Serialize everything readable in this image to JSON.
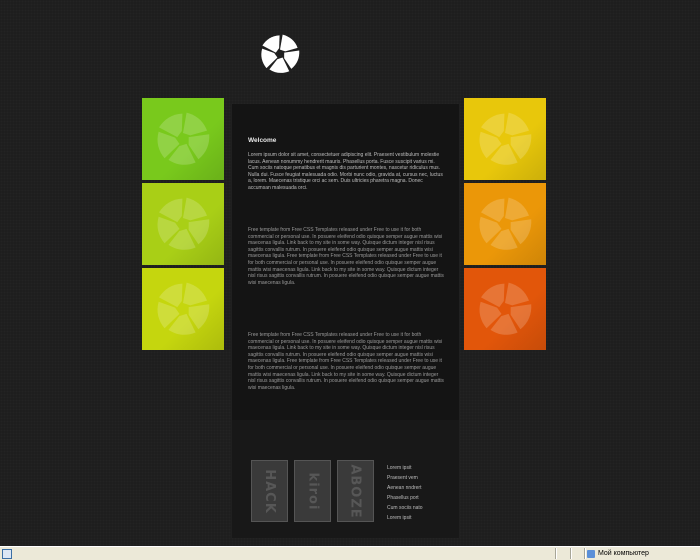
{
  "colors": {
    "page_bg": "#1e1e1e",
    "content_bg": "#141414",
    "left_tiles": [
      "#79c91c",
      "#a9cf16",
      "#c5d60e"
    ],
    "right_tiles": [
      "#e8c70b",
      "#eb9708",
      "#e2560a"
    ]
  },
  "tiles": {
    "left": [
      {
        "name": "tile-left-1",
        "color": "#79c91c"
      },
      {
        "name": "tile-left-2",
        "color": "#a9cf16"
      },
      {
        "name": "tile-left-3",
        "color": "#c5d60e"
      }
    ],
    "right": [
      {
        "name": "tile-right-1",
        "color": "#e8c70b"
      },
      {
        "name": "tile-right-2",
        "color": "#eb9708"
      },
      {
        "name": "tile-right-3",
        "color": "#e2560a"
      }
    ]
  },
  "content": {
    "welcome_title": "Welcome",
    "intro": "Lorem ipsum dolor sit amet, consectetuer adipiscing elit. Praesent vestibulum molestie lacus. Aenean nonummy hendrerit mauris. Phasellus porta. Fusce suscipit varius mi. Cum sociis natoque penatibus et magnis dis parturient montes, nascetur ridiculus mus. Nulla dui. Fusce feugiat malesuada odio. Morbi nunc odio, gravida at, cursus nec, luctus a, lorem. Maecenas tristique orci ac sem. Duis ultricies pharetra magna. Donec accumsan malesuada orci.",
    "paragraph_2": "Free template from Free CSS Templates released under Free to use it for both commercial or personal use. In posuere eleifend odio quisque semper augue mattis wisi maecenas ligula. Link back to my site in some way. Quisque dictum integer nisl risus sagittis convallis rutrum. In posuere eleifend odio quisque semper augue mattis wisi maecenas ligula. Free template from Free CSS Templates released under Free to use it for both commercial or personal use. In posuere eleifend odio quisque semper augue mattis wisi maecenas ligula. Link back to my site in some way. Quisque dictum integer nisl risus sagittis convallis rutrum. In posuere eleifend odio quisque semper augue mattis wisi maecenas ligula.",
    "paragraph_3": "Free template from Free CSS Templates released under Free to use it for both commercial or personal use. In posuere eleifend odio quisque semper augue mattis wisi maecenas ligula. Link back to my site in some way. Quisque dictum integer nisl risus sagittis convallis rutrum. In posuere eleifend odio quisque semper augue mattis wisi maecenas ligula. Free template from Free CSS Templates released under Free to use it for both commercial or personal use. In posuere eleifend odio quisque semper augue mattis wisi maecenas ligula. Link back to my site in some way. Quisque dictum integer nisl risus sagittis convallis rutrum. In posuere eleifend odio quisque semper augue mattis wisi maecenas ligula."
  },
  "footer": {
    "thumbnails": [
      "HACK",
      "kiroi",
      "ABOZE"
    ],
    "links": [
      "Lorem ipsit",
      "Praesent vem",
      "Aenean nndrert",
      "Phasellus port",
      "Cum sociis nato",
      "Lorem ipsit"
    ]
  },
  "statusbar": {
    "zone_text": "Мой компьютер"
  }
}
